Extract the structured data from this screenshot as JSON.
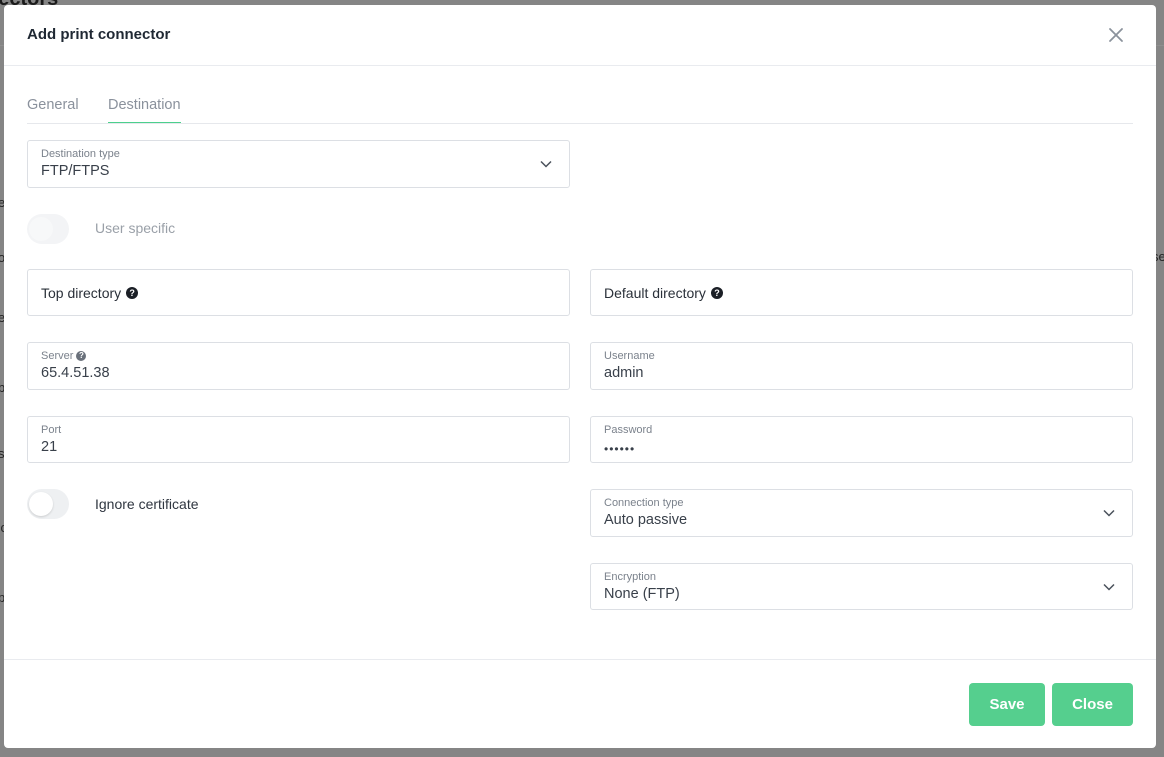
{
  "background": {
    "title": "nectors",
    "fragments": [
      "e",
      "o",
      "e",
      "b",
      "s",
      "'c",
      "p",
      "c",
      "p",
      "se"
    ]
  },
  "modal": {
    "title": "Add print connector",
    "tabs": [
      {
        "label": "General",
        "active": false
      },
      {
        "label": "Destination",
        "active": true
      }
    ],
    "destination_type": {
      "label": "Destination type",
      "value": "FTP/FTPS"
    },
    "user_specific": {
      "label": "User specific",
      "enabled": false,
      "disabled": true
    },
    "top_directory": {
      "label": "Top directory",
      "value": ""
    },
    "default_directory": {
      "label": "Default directory",
      "value": ""
    },
    "server": {
      "label": "Server",
      "value": "65.4.51.38"
    },
    "username": {
      "label": "Username",
      "value": "admin"
    },
    "port": {
      "label": "Port",
      "value": "21"
    },
    "password": {
      "label": "Password",
      "value": "••••••"
    },
    "ignore_certificate": {
      "label": "Ignore certificate",
      "enabled": false
    },
    "connection_type": {
      "label": "Connection type",
      "value": "Auto passive"
    },
    "encryption": {
      "label": "Encryption",
      "value": "None (FTP)"
    },
    "buttons": {
      "save": "Save",
      "close": "Close"
    }
  },
  "icons": {
    "close": "close-icon",
    "chevron": "chevron-down-icon",
    "help": "question-circle-icon"
  },
  "colors": {
    "accent": "#55cf8e",
    "tab_underline": "#4cd08d",
    "toggle_off": "#eef0f2"
  }
}
